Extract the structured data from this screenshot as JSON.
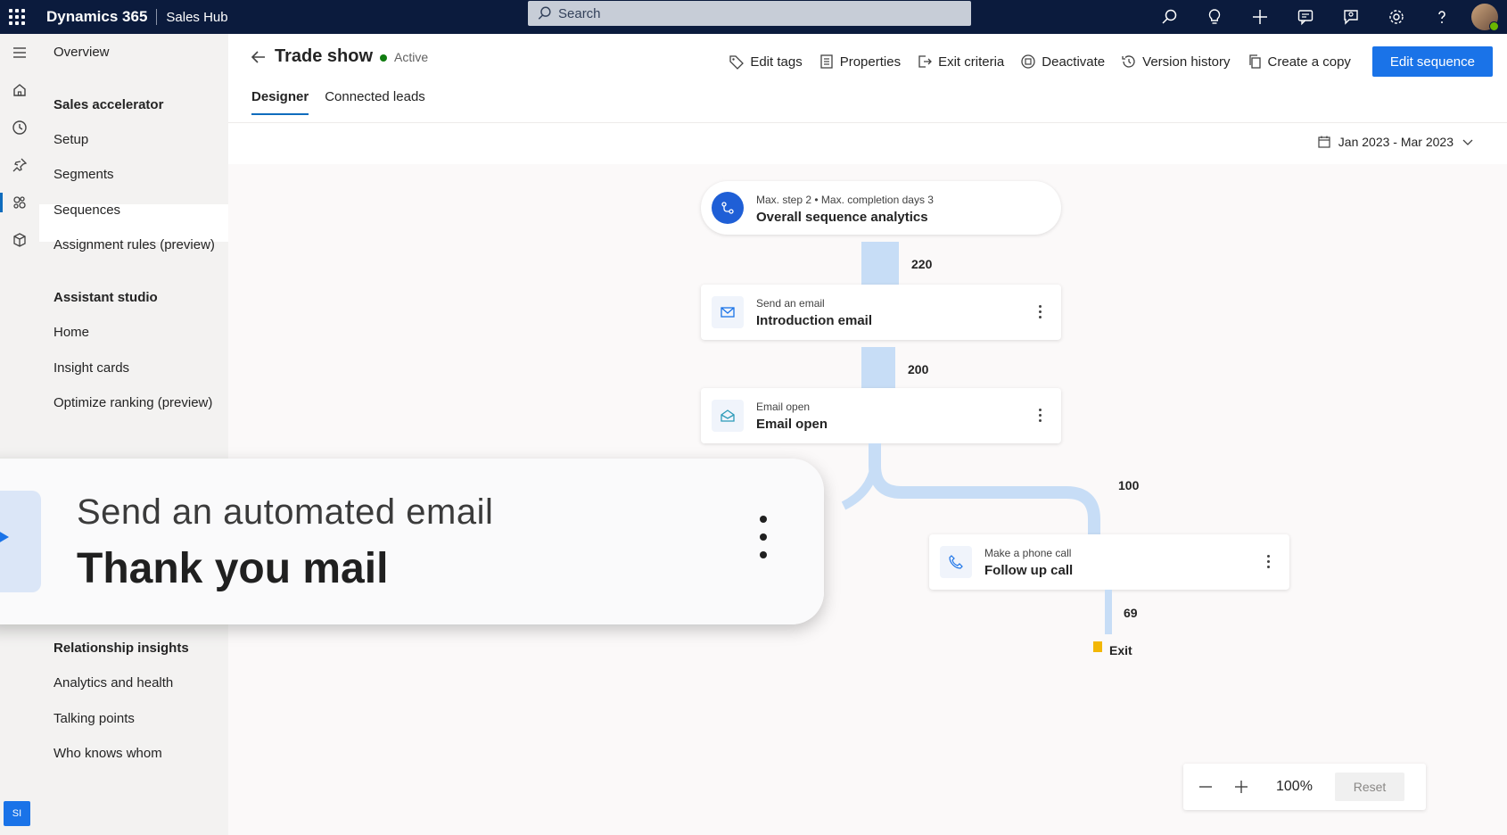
{
  "topbar": {
    "brand": "Dynamics 365",
    "app_name": "Sales Hub",
    "search_placeholder": "Search",
    "icons": [
      "search-icon",
      "lightbulb-icon",
      "plus-icon",
      "chat-icon",
      "feedback-icon",
      "settings-icon",
      "help-icon"
    ]
  },
  "rail": {
    "icons": [
      "hamburger-icon",
      "home-icon",
      "recent-icon",
      "pin-icon",
      "sales-accelerator-icon",
      "package-icon"
    ],
    "user_initials": "SI"
  },
  "sidebar": {
    "items": [
      {
        "label": "Overview",
        "type": "item"
      },
      {
        "label": "Sales accelerator",
        "type": "header"
      },
      {
        "label": "Setup",
        "type": "item"
      },
      {
        "label": "Segments",
        "type": "item"
      },
      {
        "label": "Sequences",
        "type": "item",
        "selected": true
      },
      {
        "label": "Assignment rules (preview)",
        "type": "item"
      },
      {
        "label": "Assistant studio",
        "type": "header"
      },
      {
        "label": "Home",
        "type": "item"
      },
      {
        "label": "Insight cards",
        "type": "item"
      },
      {
        "label": "Optimize ranking (preview)",
        "type": "item"
      },
      {
        "label": "Relationship insights",
        "type": "header"
      },
      {
        "label": "Analytics and health",
        "type": "item"
      },
      {
        "label": "Talking points",
        "type": "item"
      },
      {
        "label": "Who knows whom",
        "type": "item"
      }
    ]
  },
  "header": {
    "title": "Trade show",
    "status": "Active",
    "status_color": "#107c10",
    "actions": [
      {
        "label": "Edit tags",
        "icon": "tag-icon"
      },
      {
        "label": "Properties",
        "icon": "properties-icon"
      },
      {
        "label": "Exit criteria",
        "icon": "exit-criteria-icon"
      },
      {
        "label": "Deactivate",
        "icon": "deactivate-icon"
      },
      {
        "label": "Version history",
        "icon": "history-icon"
      },
      {
        "label": "Create a copy",
        "icon": "copy-icon"
      }
    ],
    "primary_action": "Edit sequence"
  },
  "tabs": [
    {
      "label": "Designer",
      "active": true
    },
    {
      "label": "Connected leads",
      "active": false
    }
  ],
  "date_range": "Jan 2023 - Mar 2023",
  "sequence": {
    "overall": {
      "subtitle": "Max. step 2 • Max. completion days 3",
      "title": "Overall sequence analytics"
    },
    "steps": [
      {
        "count": "220",
        "subtitle": "Send an email",
        "title": "Introduction email"
      },
      {
        "count": "200",
        "subtitle": "Email open",
        "title": "Email open"
      },
      {
        "count": "100",
        "subtitle": "Make a phone call",
        "title": "Follow up call"
      }
    ],
    "exit_count": "69",
    "exit_label": "Exit"
  },
  "zoom": {
    "level": "100%",
    "reset_label": "Reset"
  },
  "callout": {
    "subtitle": "Send an automated email",
    "title": "Thank you mail"
  },
  "colors": {
    "accent": "#1a73e8",
    "topbar": "#0b1b3d",
    "flow": "#c7ddf6"
  }
}
